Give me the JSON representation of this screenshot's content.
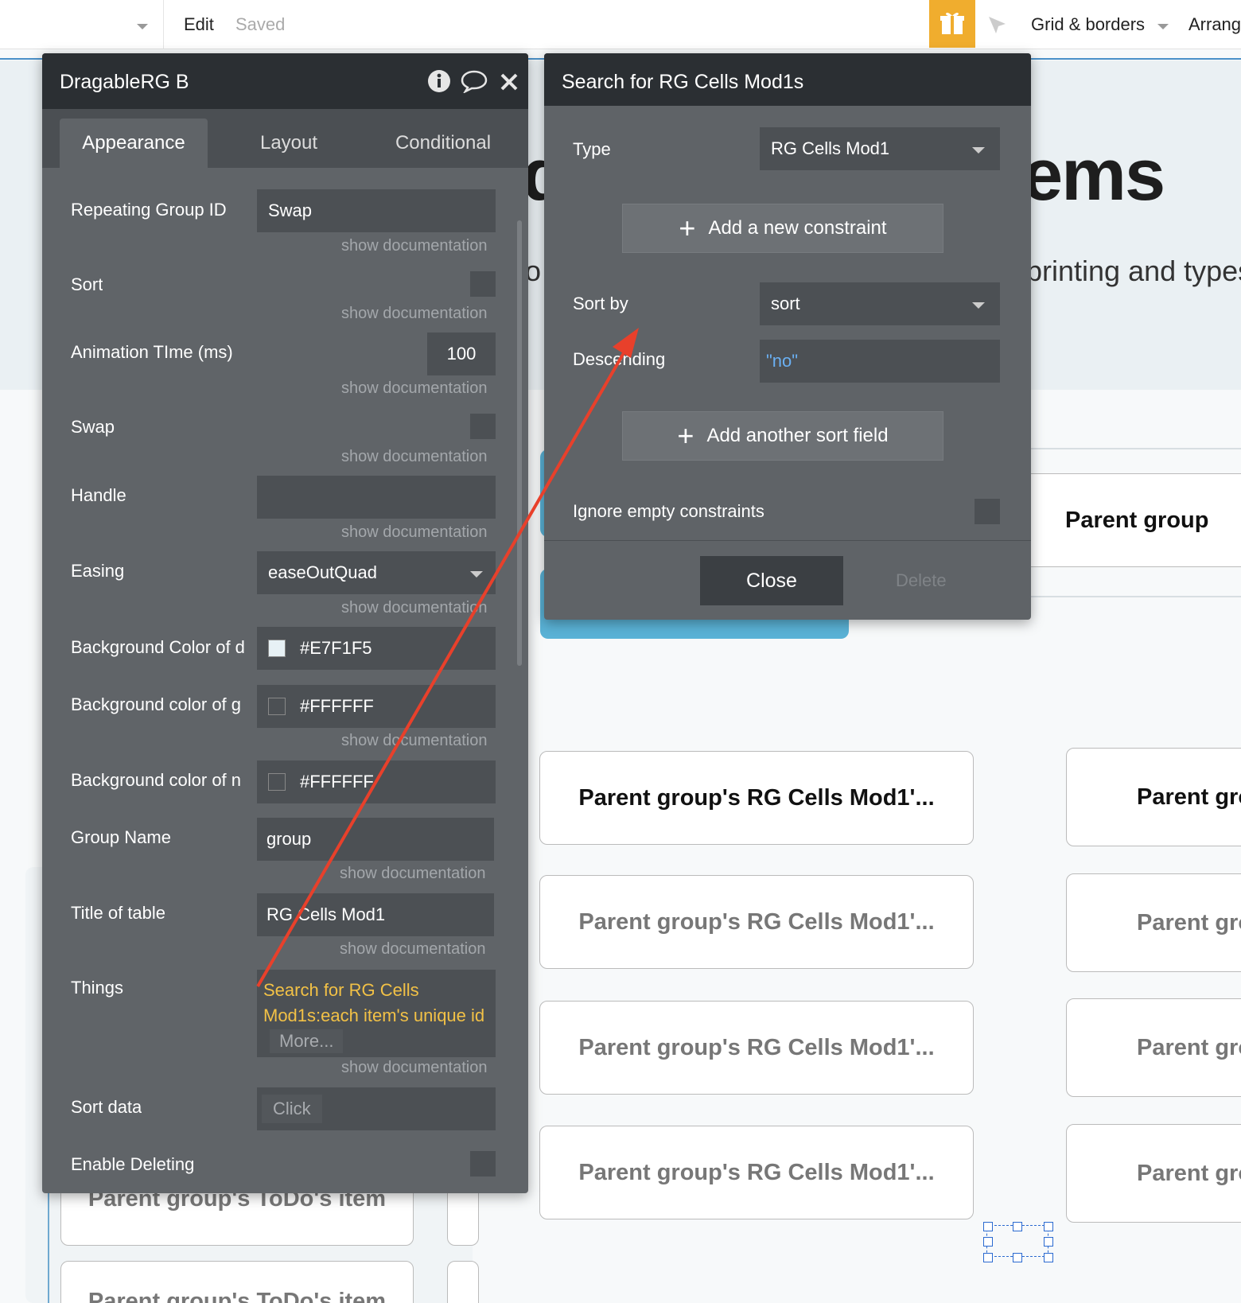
{
  "topbar": {
    "edit": "Edit",
    "saved": "Saved",
    "grid_borders": "Grid & borders",
    "arrange": "Arrang"
  },
  "canvas": {
    "heading_right": "ems",
    "heading_left": "d",
    "subtitle_right": "printing and types",
    "subtitle_left": "o",
    "card_label": "Parent group's RG Cells Mod1'...",
    "card_label_short": "Parent gro",
    "card_label_top": "Parent group",
    "todo_label": "Parent group's ToDo's item"
  },
  "element_panel": {
    "title": "DragableRG B",
    "tabs": [
      "Appearance",
      "Layout",
      "Conditional"
    ],
    "doc_link": "show documentation",
    "rows": {
      "rg_id": {
        "label": "Repeating Group ID",
        "value": "Swap"
      },
      "sort": {
        "label": "Sort"
      },
      "anim": {
        "label": "Animation TIme (ms)",
        "value": "100"
      },
      "swap": {
        "label": "Swap"
      },
      "handle": {
        "label": "Handle",
        "value": ""
      },
      "easing": {
        "label": "Easing",
        "value": "easeOutQuad"
      },
      "bg_d": {
        "label": "Background Color of d",
        "value": "#E7F1F5"
      },
      "bg_g": {
        "label": "Background color of g",
        "value": "#FFFFFF"
      },
      "bg_n": {
        "label": "Background color of n",
        "value": "#FFFFFF"
      },
      "group_name": {
        "label": "Group Name",
        "value": "group"
      },
      "title_table": {
        "label": "Title of table",
        "value": "RG Cells Mod1"
      },
      "things": {
        "label": "Things",
        "line1": "Search for RG Cells",
        "line2": "Mod1s:each item's unique id",
        "more": "More..."
      },
      "sort_data": {
        "label": "Sort data",
        "button": "Click"
      },
      "enable_deleting": {
        "label": "Enable Deleting"
      }
    }
  },
  "search_panel": {
    "title": "Search for RG Cells Mod1s",
    "type_label": "Type",
    "type_value": "RG Cells Mod1",
    "add_constraint": "Add a new constraint",
    "sort_by_label": "Sort by",
    "sort_by_value": "sort",
    "descending_label": "Descending",
    "descending_value": "\"no\"",
    "add_sort_field": "Add another sort field",
    "ignore_empty": "Ignore empty constraints",
    "close": "Close",
    "delete": "Delete"
  },
  "colors": {
    "panel_bg": "#606468",
    "panel_head": "#2b2f33",
    "field_bg": "#4c5054",
    "expression": "#f2c146",
    "arrow": "#e8402b",
    "gift": "#f0ad2e",
    "blue_text": "#6ab0f3"
  }
}
